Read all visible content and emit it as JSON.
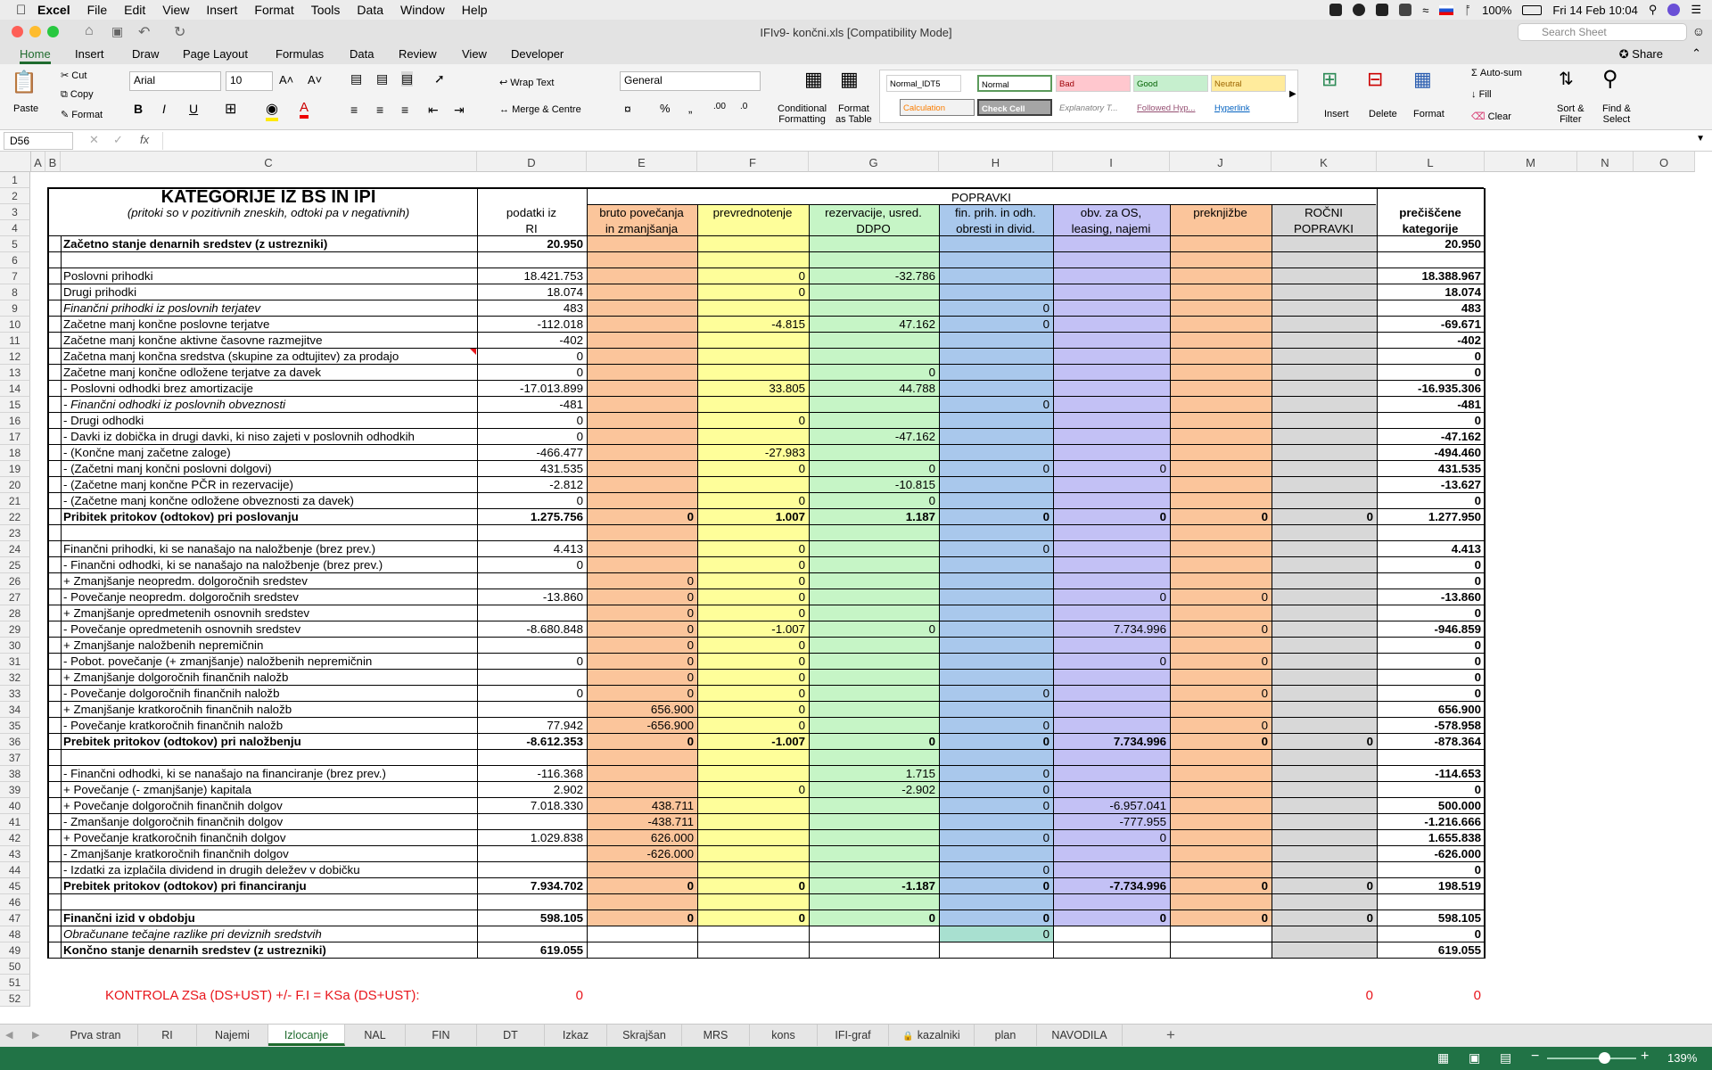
{
  "menubar": {
    "app": "Excel",
    "items": [
      "File",
      "Edit",
      "View",
      "Insert",
      "Format",
      "Tools",
      "Data",
      "Window",
      "Help"
    ],
    "battery": "100%",
    "datetime": "Fri 14 Feb  10:04"
  },
  "window": {
    "title": "IFIv9- končni.xls  [Compatibility Mode]",
    "search_placeholder": "Search Sheet",
    "share": "Share"
  },
  "ribbon_tabs": [
    "Home",
    "Insert",
    "Draw",
    "Page Layout",
    "Formulas",
    "Data",
    "Review",
    "View",
    "Developer"
  ],
  "ribbon": {
    "paste": "Paste",
    "cut": "Cut",
    "copy": "Copy",
    "format": "Format",
    "font": "Arial",
    "size": "10",
    "wrap": "Wrap Text",
    "merge": "Merge & Centre",
    "number_format": "General",
    "cond": "Conditional",
    "cond2": "Formatting",
    "fat": "Format",
    "fat2": "as Table",
    "insert": "Insert",
    "delete": "Delete",
    "format_btn": "Format",
    "autosum": "Auto-sum",
    "fill": "Fill",
    "clear": "Clear",
    "sort": "Sort &",
    "sort2": "Filter",
    "find": "Find &",
    "find2": "Select",
    "styles": {
      "normal_idt5": "Normal_IDT5",
      "normal": "Normal",
      "bad": "Bad",
      "good": "Good",
      "neutral": "Neutral",
      "calculation": "Calculation",
      "check": "Check Cell",
      "explanatory": "Explanatory T...",
      "followed": "Followed Hyp...",
      "hyperlink": "Hyperlink"
    }
  },
  "formula_bar": {
    "name_box": "D56",
    "fx": "fx",
    "content": ""
  },
  "columns": [
    "A",
    "B",
    "C",
    "D",
    "E",
    "F",
    "G",
    "H",
    "I",
    "J",
    "K",
    "L",
    "M",
    "N",
    "O"
  ],
  "header": {
    "title": "KATEGORIJE IZ BS IN IPI",
    "subtitle": "(pritoki so v pozitivnih zneskih, odtoki pa v negativnih)",
    "popravki": "POPRAVKI",
    "d3a": "podatki iz",
    "d3b": "RI",
    "e3a": "bruto povečanja",
    "e3b": "in zmanjšanja",
    "f3": "prevrednotenje",
    "g3a": "rezervacije, usred.",
    "g3b": "DDPO",
    "h3a": "fin. prih. in odh.",
    "h3b": "obresti in divid.",
    "i3a": "obv. za OS,",
    "i3b": "leasing, najemi",
    "j3": "preknjižbe",
    "k3a": "ROČNI",
    "k3b": "POPRAVKI",
    "l3a": "prečiščene",
    "l3b": "kategorije"
  },
  "rows": [
    {
      "r": 5,
      "c": "Začetno stanje denarnih sredstev (z ustrezniki)",
      "st": "b",
      "d": "20.950",
      "l": "20.950"
    },
    {
      "r": 7,
      "c": "Poslovni prihodki",
      "d": "18.421.753",
      "f": "0",
      "g": "-32.786",
      "l": "18.388.967"
    },
    {
      "r": 8,
      "c": "Drugi prihodki",
      "d": "18.074",
      "f": "0",
      "l": "18.074"
    },
    {
      "r": 9,
      "c": "Finančni prihodki iz poslovnih terjatev",
      "st": "i",
      "d": "483",
      "h": "0",
      "l": "483"
    },
    {
      "r": 10,
      "c": "Začetne manj končne poslovne terjatve",
      "d": "-112.018",
      "f": "-4.815",
      "g": "47.162",
      "h": "0",
      "l": "-69.671"
    },
    {
      "r": 11,
      "c": "Začetne manj končne aktivne časovne razmejitve",
      "d": "-402",
      "l": "-402"
    },
    {
      "r": 12,
      "c": "Začetna manj končna sredstva (skupine za odtujitev) za prodajo",
      "d": "0",
      "l": "0"
    },
    {
      "r": 13,
      "c": "Začetne manj končne odložene terjatve za davek",
      "d": "0",
      "g": "0",
      "l": "0"
    },
    {
      "r": 14,
      "c": " - Poslovni odhodki brez amortizacije",
      "d": "-17.013.899",
      "f": "33.805",
      "g": "44.788",
      "l": "-16.935.306"
    },
    {
      "r": 15,
      "c": " - Finančni odhodki iz poslovnih obveznosti",
      "st": "i",
      "d": "-481",
      "h": "0",
      "l": "-481"
    },
    {
      "r": 16,
      "c": " - Drugi odhodki",
      "d": "0",
      "f": "0",
      "l": "0"
    },
    {
      "r": 17,
      "c": " - Davki iz dobička in drugi davki, ki niso zajeti v poslovnih odhodkih",
      "d": "0",
      "g": "-47.162",
      "l": "-47.162"
    },
    {
      "r": 18,
      "c": " - (Končne manj začetne zaloge)",
      "d": "-466.477",
      "f": "-27.983",
      "l": "-494.460"
    },
    {
      "r": 19,
      "c": " - (Začetni manj končni poslovni dolgovi)",
      "d": "431.535",
      "f": "0",
      "g": "0",
      "h": "0",
      "i": "0",
      "l": "431.535"
    },
    {
      "r": 20,
      "c": " - (Začetne manj končne PČR in rezervacije)",
      "d": "-2.812",
      "g": "-10.815",
      "l": "-13.627"
    },
    {
      "r": 21,
      "c": " - (Začetne manj končne odložene obveznosti za davek)",
      "d": "0",
      "f": "0",
      "g": "0",
      "l": "0"
    },
    {
      "r": 22,
      "c": "Pribitek pritokov (odtokov) pri poslovanju",
      "st": "b",
      "d": "1.275.756",
      "e": "0",
      "f": "1.007",
      "g": "1.187",
      "h": "0",
      "i": "0",
      "j": "0",
      "k": "0",
      "l": "1.277.950"
    },
    {
      "r": 24,
      "c": "Finančni prihodki, ki se nanašajo na naložbenje (brez prev.)",
      "d": "4.413",
      "f": "0",
      "h": "0",
      "l": "4.413"
    },
    {
      "r": 25,
      "c": " - Finančni odhodki, ki se nanašajo na naložbenje (brez prev.)",
      "d": "0",
      "f": "0",
      "l": "0"
    },
    {
      "r": 26,
      "c": "+ Zmanjšanje neopredm. dolgoročnih sredstev",
      "e": "0",
      "f": "0",
      "l": "0"
    },
    {
      "r": 27,
      "c": "-  Povečanje neopredm. dolgoročnih sredstev",
      "d": "-13.860",
      "e": "0",
      "f": "0",
      "i": "0",
      "j": "0",
      "l": "-13.860"
    },
    {
      "r": 28,
      "c": "+ Zmanjšanje opredmetenih osnovnih sredstev",
      "e": "0",
      "f": "0",
      "l": "0"
    },
    {
      "r": 29,
      "c": "-  Povečanje opredmetenih osnovnih sredstev",
      "d": "-8.680.848",
      "e": "0",
      "f": "-1.007",
      "g": "0",
      "i": "7.734.996",
      "j": "0",
      "l": "-946.859"
    },
    {
      "r": 30,
      "c": "+ Zmanjšanje naložbenih nepremičnin",
      "e": "0",
      "f": "0",
      "l": "0"
    },
    {
      "r": 31,
      "c": "-  Pobot. povečanje (+ zmanjšanje) naložbenih nepremičnin",
      "d": "0",
      "e": "0",
      "f": "0",
      "i": "0",
      "j": "0",
      "l": "0"
    },
    {
      "r": 32,
      "c": "+ Zmanjšanje dolgoročnih finančnih naložb",
      "e": "0",
      "f": "0",
      "l": "0"
    },
    {
      "r": 33,
      "c": "-  Povečanje  dolgoročnih finančnih naložb",
      "d": "0",
      "e": "0",
      "f": "0",
      "h": "0",
      "j": "0",
      "l": "0"
    },
    {
      "r": 34,
      "c": "+ Zmanjšanje kratkoročnih finančnih naložb",
      "e": "656.900",
      "f": "0",
      "l": "656.900"
    },
    {
      "r": 35,
      "c": "-  Povečanje kratkoročnih finančnih naložb",
      "d": "77.942",
      "e": "-656.900",
      "f": "0",
      "h": "0",
      "j": "0",
      "l": "-578.958"
    },
    {
      "r": 36,
      "c": "Prebitek pritokov (odtokov) pri naložbenju",
      "st": "b",
      "d": "-8.612.353",
      "e": "0",
      "f": "-1.007",
      "g": "0",
      "h": "0",
      "i": "7.734.996",
      "j": "0",
      "k": "0",
      "l": "-878.364"
    },
    {
      "r": 38,
      "c": " - Finančni odhodki, ki se nanašajo na financiranje (brez prev.)",
      "d": "-116.368",
      "g": "1.715",
      "h": "0",
      "l": "-114.653"
    },
    {
      "r": 39,
      "c": "+ Povečanje (- zmanjšanje) kapitala",
      "d": "2.902",
      "f": "0",
      "g": "-2.902",
      "h": "0",
      "l": "0"
    },
    {
      "r": 40,
      "c": "+ Povečanje dolgoročnih finančnih dolgov",
      "d": "7.018.330",
      "e": "438.711",
      "h": "0",
      "i": "-6.957.041",
      "l": "500.000"
    },
    {
      "r": 41,
      "c": "-  Zmanšanje dolgoročnih finančnih dolgov",
      "e": "-438.711",
      "i": "-777.955",
      "l": "-1.216.666"
    },
    {
      "r": 42,
      "c": "+ Povečanje kratkoročnih finančnih dolgov",
      "d": "1.029.838",
      "e": "626.000",
      "h": "0",
      "i": "0",
      "l": "1.655.838"
    },
    {
      "r": 43,
      "c": "-  Zmanjšanje kratkoročnih finančnih dolgov",
      "e": "-626.000",
      "l": "-626.000"
    },
    {
      "r": 44,
      "c": " - Izdatki za izplačila dividend in drugih deležev v dobičku",
      "h": "0",
      "l": "0"
    },
    {
      "r": 45,
      "c": "Prebitek pritokov (odtokov) pri financiranju",
      "st": "b",
      "d": "7.934.702",
      "e": "0",
      "f": "0",
      "g": "-1.187",
      "h": "0",
      "i": "-7.734.996",
      "j": "0",
      "k": "0",
      "l": "198.519"
    },
    {
      "r": 47,
      "c": "Finančni izid v obdobju",
      "st": "b",
      "d": "598.105",
      "e": "0",
      "f": "0",
      "g": "0",
      "h": "0",
      "i": "0",
      "j": "0",
      "k": "0",
      "l": "598.105"
    },
    {
      "r": 48,
      "c": "Obračunane tečajne razlike pri deviznih sredstvih",
      "st": "i",
      "h": "0",
      "l": "0"
    },
    {
      "r": 49,
      "c": "Končno stanje denarnih sredstev (z ustrezniki)",
      "st": "b",
      "d": "619.055",
      "l": "619.055"
    }
  ],
  "control_row": {
    "label": "KONTROLA ZSa (DS+UST) +/- F.I = KSa (DS+UST):",
    "d": "0",
    "k": "0",
    "l": "0"
  },
  "sheet_tabs": [
    "Prva stran",
    "RI",
    "Najemi",
    "Izlocanje",
    "NAL",
    "FIN",
    "DT",
    "Izkaz",
    "Skrajšan",
    "MRS",
    "kons",
    "IFI-graf",
    "kazalniki",
    "plan",
    "NAVODILA"
  ],
  "active_sheet": "Izlocanje",
  "status": {
    "zoom": "139%"
  },
  "colors": {
    "orange": "#fbc59b",
    "yellow": "#fefe9a",
    "green": "#c6f5c6",
    "blue": "#a9c8ec",
    "purple": "#c3c1f5",
    "gray": "#d8d8d8",
    "excel_green": "#217346"
  }
}
